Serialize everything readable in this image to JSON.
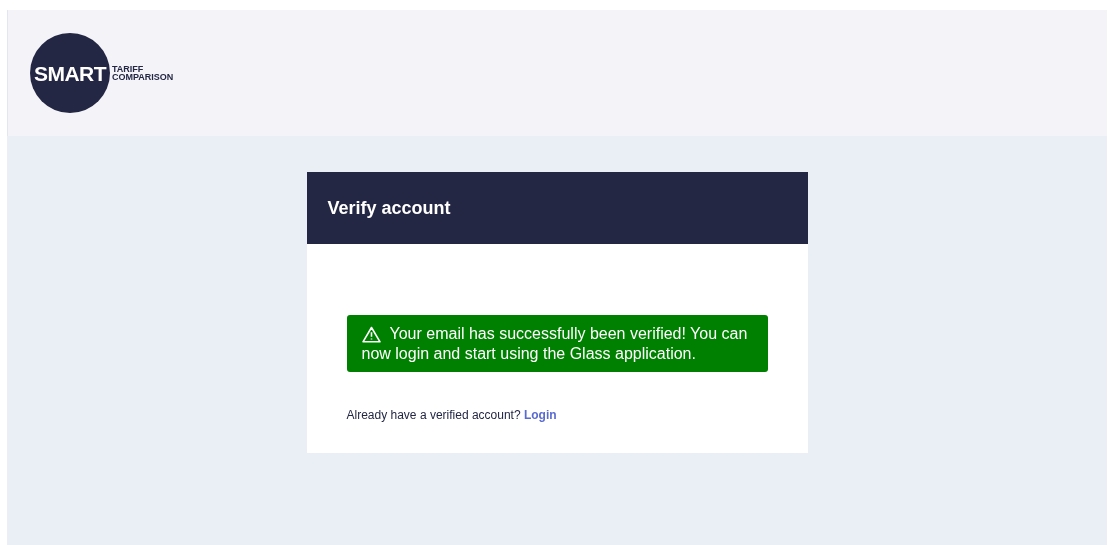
{
  "logo": {
    "brand": "SMART",
    "tagline_line_1": "TARIFF",
    "tagline_line_2": "COMPARISON"
  },
  "card": {
    "title": "Verify account",
    "alert": {
      "kind": "success",
      "message_line_1": "Your email has successfully been verified! You can",
      "message_line_2": "now login and start using the Glass application."
    },
    "prompt": "Already have a verified account?",
    "link": "Login"
  }
}
